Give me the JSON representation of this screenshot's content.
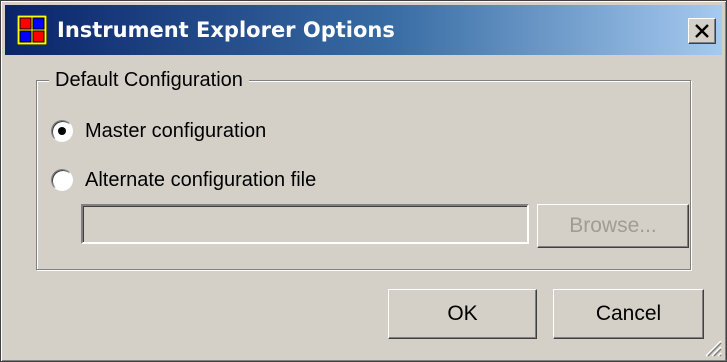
{
  "window": {
    "title": "Instrument Explorer Options",
    "close_glyph": "X"
  },
  "group": {
    "label": "Default Configuration"
  },
  "options": [
    {
      "label": "Master configuration",
      "selected": true
    },
    {
      "label": "Alternate configuration file",
      "selected": false
    }
  ],
  "file_path": {
    "value": "",
    "enabled": false
  },
  "buttons": {
    "browse": "Browse...",
    "ok": "OK",
    "cancel": "Cancel"
  },
  "icons": {
    "app": "instrument-explorer-app-icon",
    "close": "close-icon",
    "grip": "resize-grip-icon"
  }
}
